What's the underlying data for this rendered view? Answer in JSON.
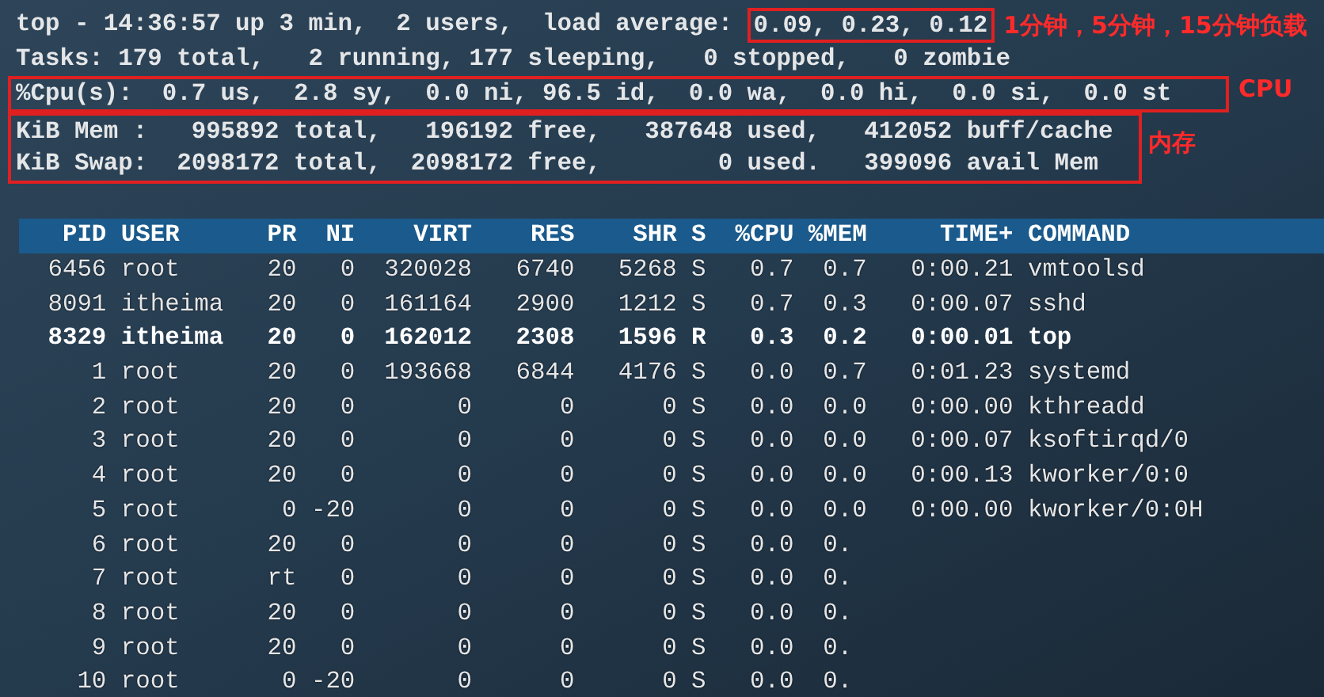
{
  "summary": {
    "uptime_line": "top - 14:36:57 up 3 min,  2 users,  load average: ",
    "load_average": "0.09, 0.23, 0.12",
    "tasks_line": "Tasks: 179 total,   2 running, 177 sleeping,   0 stopped,   0 zombie",
    "cpu_line": "%Cpu(s):  0.7 us,  2.8 sy,  0.0 ni, 96.5 id,  0.0 wa,  0.0 hi,  0.0 si,  0.0 st",
    "mem_line": "KiB Mem :   995892 total,   196192 free,   387648 used,   412052 buff/cache",
    "swap_line": "KiB Swap:  2098172 total,  2098172 free,        0 used.   399096 avail Mem"
  },
  "annotations": {
    "load": "1分钟，5分钟，15分钟负载",
    "cpu": "CPU",
    "memory": "内存"
  },
  "table": {
    "columns": [
      "PID",
      "USER",
      "PR",
      "NI",
      "VIRT",
      "RES",
      "SHR",
      "S",
      "%CPU",
      "%MEM",
      "TIME+",
      "COMMAND"
    ],
    "rows": [
      {
        "bold": false,
        "cells": [
          "6456",
          "root",
          "20",
          "0",
          "320028",
          "6740",
          "5268",
          "S",
          "0.7",
          "0.7",
          "0:00.21",
          "vmtoolsd"
        ]
      },
      {
        "bold": false,
        "cells": [
          "8091",
          "itheima",
          "20",
          "0",
          "161164",
          "2900",
          "1212",
          "S",
          "0.7",
          "0.3",
          "0:00.07",
          "sshd"
        ]
      },
      {
        "bold": true,
        "cells": [
          "8329",
          "itheima",
          "20",
          "0",
          "162012",
          "2308",
          "1596",
          "R",
          "0.3",
          "0.2",
          "0:00.01",
          "top"
        ]
      },
      {
        "bold": false,
        "cells": [
          "1",
          "root",
          "20",
          "0",
          "193668",
          "6844",
          "4176",
          "S",
          "0.0",
          "0.7",
          "0:01.23",
          "systemd"
        ]
      },
      {
        "bold": false,
        "cells": [
          "2",
          "root",
          "20",
          "0",
          "0",
          "0",
          "0",
          "S",
          "0.0",
          "0.0",
          "0:00.00",
          "kthreadd"
        ]
      },
      {
        "bold": false,
        "cells": [
          "3",
          "root",
          "20",
          "0",
          "0",
          "0",
          "0",
          "S",
          "0.0",
          "0.0",
          "0:00.07",
          "ksoftirqd/0"
        ]
      },
      {
        "bold": false,
        "cells": [
          "4",
          "root",
          "20",
          "0",
          "0",
          "0",
          "0",
          "S",
          "0.0",
          "0.0",
          "0:00.13",
          "kworker/0:0"
        ]
      },
      {
        "bold": false,
        "cells": [
          "5",
          "root",
          "0",
          "-20",
          "0",
          "0",
          "0",
          "S",
          "0.0",
          "0.0",
          "0:00.00",
          "kworker/0:0H"
        ]
      },
      {
        "bold": false,
        "cells": [
          "6",
          "root",
          "20",
          "0",
          "0",
          "0",
          "0",
          "S",
          "0.0",
          "0."
        ]
      },
      {
        "bold": false,
        "cells": [
          "7",
          "root",
          "rt",
          "0",
          "0",
          "0",
          "0",
          "S",
          "0.0",
          "0."
        ]
      },
      {
        "bold": false,
        "cells": [
          "8",
          "root",
          "20",
          "0",
          "0",
          "0",
          "0",
          "S",
          "0.0",
          "0."
        ]
      },
      {
        "bold": false,
        "cells": [
          "9",
          "root",
          "20",
          "0",
          "0",
          "0",
          "0",
          "S",
          "0.0",
          "0."
        ]
      },
      {
        "bold": false,
        "cells": [
          "10",
          "root",
          "0",
          "-20",
          "0",
          "0",
          "0",
          "S",
          "0.0",
          "0."
        ]
      }
    ]
  }
}
